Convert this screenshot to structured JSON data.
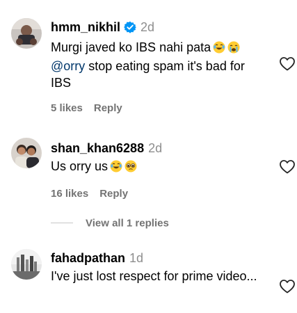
{
  "comments": [
    {
      "username": "hmm_nikhil",
      "verified": true,
      "time": "2d",
      "lines": [
        "Murgi javed ko IBS nahi pata"
      ],
      "mention": "@orry",
      "mention_text": " stop eating spam it's bad for IBS",
      "emojis": [
        "laughing-tears-emoji",
        "crying-emoji"
      ],
      "likes": "5 likes",
      "reply": "Reply"
    },
    {
      "username": "shan_khan6288",
      "verified": false,
      "time": "2d",
      "text": "Us orry us",
      "emojis": [
        "laughing-tears-emoji",
        "pleading-emoji"
      ],
      "likes": "16 likes",
      "reply": "Reply"
    },
    {
      "username": "fahadpathan",
      "verified": false,
      "time": "1d",
      "text": "I've just lost respect for prime video..."
    }
  ],
  "view_replies": "View all 1 replies",
  "colors": {
    "text": "#000000",
    "muted": "#737373",
    "timestamp": "#8e8e8e",
    "mention": "#00376b",
    "verified": "#0095f6"
  },
  "icons": [
    "verified-badge-icon",
    "heart-outline-icon"
  ]
}
